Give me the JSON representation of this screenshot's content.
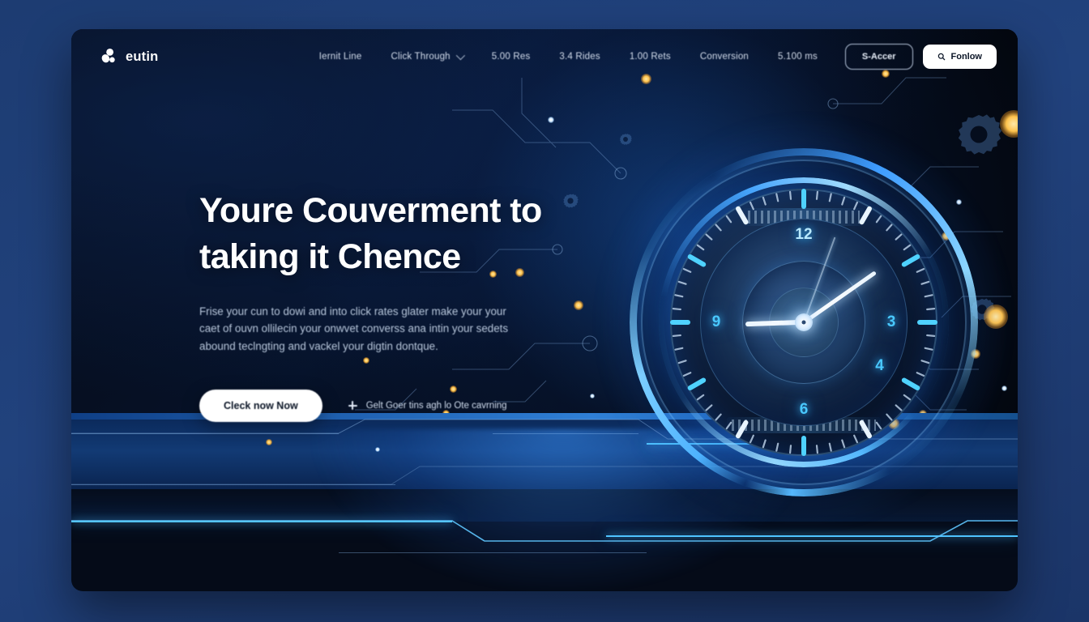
{
  "brand": {
    "name": "eutin",
    "mark_icon": "eutin-logo-mark"
  },
  "nav": {
    "links": [
      {
        "label": "Iernit Line",
        "has_chevron": false
      },
      {
        "label": "Click Through",
        "has_chevron": true
      },
      {
        "label": "5.00 Res",
        "has_chevron": false
      },
      {
        "label": "3.4 Rides",
        "has_chevron": false
      },
      {
        "label": "1.00 Rets",
        "has_chevron": false
      },
      {
        "label": "Conversion",
        "has_chevron": false
      },
      {
        "label": "5.100 ms",
        "has_chevron": false
      }
    ],
    "outline_button": {
      "label": "S-Accer",
      "icon": ""
    },
    "solid_button": {
      "label": "Fonlow",
      "icon": "search-icon"
    }
  },
  "hero": {
    "headline_line1": "Youre Couverment to",
    "headline_line2": "taking it Chence",
    "paragraph": "Frise your cun to dowi and into click rates glater make your your caet of ouvn ollilecin your onwvet converss ana intin your sedets abound teclngting and vackel your digtin dontque.",
    "cta_primary": "Cleck now Now",
    "cta_secondary": "Gelt Goer tins agh lo Ote cavrning",
    "cta_secondary_icon": "plus-icon"
  },
  "clock": {
    "numerals": [
      {
        "value": "12",
        "angle": 0
      },
      {
        "value": "3",
        "angle": 90
      },
      {
        "value": "4",
        "angle": 120
      },
      {
        "value": "6",
        "angle": 180
      },
      {
        "value": "9",
        "angle": 270
      }
    ],
    "hour_angle": 268,
    "minute_angle": 55,
    "second_angle": 20,
    "tick_count": 60
  },
  "colors": {
    "page_background": "#22417a",
    "card_background": "#050b18",
    "accent_blue": "#4fb4ff",
    "numeral_cyan": "#49c8ff",
    "spark_gold": "#ffc34d",
    "text_primary": "#ffffff",
    "text_muted": "#c3d2e6"
  }
}
